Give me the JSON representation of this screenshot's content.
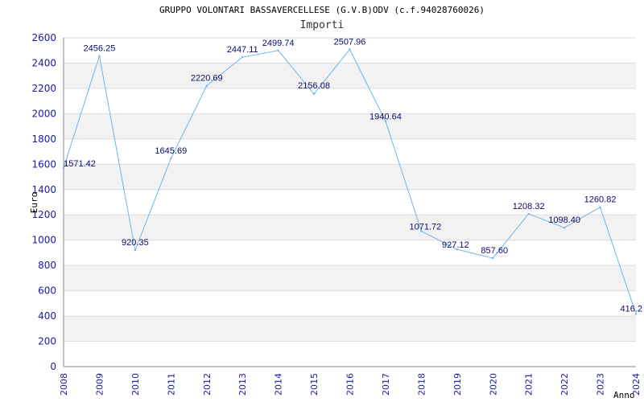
{
  "chart_data": {
    "type": "line",
    "title": "GRUPPO VOLONTARI BASSAVERCELLESE (G.V.B)ODV (c.f.94028760026)",
    "subtitle": "Importi",
    "ylabel": "Euro",
    "xlabel": "Anno",
    "ylim": [
      0,
      2600
    ],
    "yticks": [
      "0",
      "200",
      "400",
      "600",
      "800",
      "1000",
      "1200",
      "1400",
      "1600",
      "1800",
      "2000",
      "2200",
      "2400",
      "2600"
    ],
    "categories": [
      "2008",
      "2009",
      "2010",
      "2011",
      "2012",
      "2013",
      "2014",
      "2015",
      "2016",
      "2017",
      "2018",
      "2019",
      "2020",
      "2021",
      "2022",
      "2023",
      "2024"
    ],
    "values": [
      1571.42,
      2456.25,
      920.35,
      1645.69,
      2220.69,
      2447.11,
      2499.74,
      2156.08,
      2507.96,
      1940.64,
      1071.72,
      927.12,
      857.6,
      1208.32,
      1098.4,
      1260.82,
      416.2
    ],
    "data_labels": [
      "1571.42",
      "2456.25",
      "920.35",
      "1645.69",
      "2220.69",
      "2447.11",
      "2499.74",
      "2156.08",
      "2507.96",
      "1940.64",
      "1071.72",
      "927.12",
      "857.60",
      "1208.32",
      "1098.40",
      "1260.82",
      "416.2"
    ],
    "grid": true,
    "colors": {
      "line": "#6fb3ea",
      "band": "#f2f2f2",
      "tick": "#1a1aa6",
      "label": "#0a0a6e"
    }
  }
}
